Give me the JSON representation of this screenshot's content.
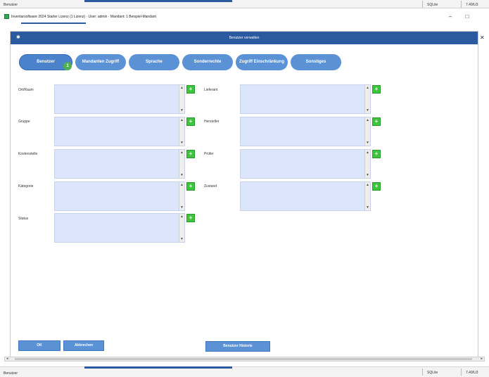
{
  "status_top": {
    "left_text": "Benutzer",
    "cell1": "SQLite",
    "cell2": "7.49/U3"
  },
  "app": {
    "title": "Inventarsoftware 2024 Starter Lizenz (1 Lizenz) · User: admin · Mandant: 1 Beispiel-Mandant",
    "minimize": "–",
    "maximize": "□"
  },
  "dialog": {
    "title": "Benutzer verwalten",
    "icon": "✱",
    "close": "✕"
  },
  "tabs": [
    {
      "label": "Benutzer"
    },
    {
      "label": "Mandanten Zugriff"
    },
    {
      "label": "Sprache"
    },
    {
      "label": "Sonderrechte"
    },
    {
      "label": "Zugriff Einschränkung"
    },
    {
      "label": "Sonstiges"
    }
  ],
  "active_tab_badge": "1",
  "filters_left": [
    {
      "label": "Ort/Raum"
    },
    {
      "label": "Gruppe"
    },
    {
      "label": "Kostenstelle"
    },
    {
      "label": "Kategorie"
    },
    {
      "label": "Status"
    }
  ],
  "filters_right": [
    {
      "label": "Lieferant"
    },
    {
      "label": "Hersteller"
    },
    {
      "label": "Prüfer"
    },
    {
      "label": "Zustand"
    }
  ],
  "plus_symbol": "+",
  "footer": {
    "ok": "OK",
    "cancel": "Abbrechen",
    "history": "Benutzer Historie"
  },
  "status_bottom": {
    "left_text": "Benutzer",
    "cell1": "SQLite",
    "cell2": "7.49/U3"
  }
}
